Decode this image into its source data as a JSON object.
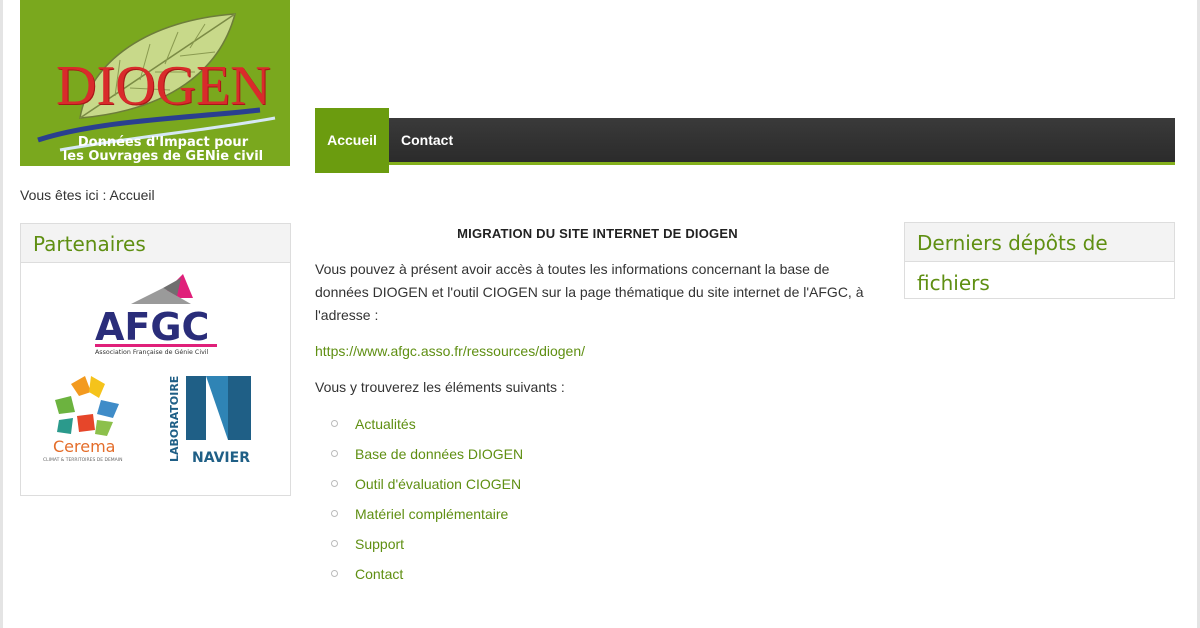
{
  "logo": {
    "title": "DIOGEN",
    "subtitle_line1": "Données d'Impact pour",
    "subtitle_line2": "les Ouvrages de GENie civil",
    "background": "#7aa81e",
    "title_color": "#d92b2b"
  },
  "nav": {
    "items": [
      {
        "label": "Accueil",
        "active": true
      },
      {
        "label": "Contact",
        "active": false
      }
    ],
    "active_color": "#6b9c0f",
    "bar_color": "#2e2e2e"
  },
  "breadcrumb": "Vous êtes ici : Accueil",
  "sidebar_left": {
    "title": "Partenaires",
    "logos": [
      {
        "name": "AFGC",
        "caption": "Association Française de Génie Civil"
      },
      {
        "name": "Cerema",
        "caption": "CLIMAT & TERRITOIRES DE DEMAIN"
      },
      {
        "name": "NAVIER",
        "caption": "LABORATOIRE"
      }
    ]
  },
  "sidebar_right": {
    "title": "Derniers dépôts de fichiers"
  },
  "main": {
    "title": "MIGRATION DU SITE INTERNET DE DIOGEN",
    "paragraph1_line1": "Vous pouvez à présent avoir accès à toutes les informations concernant la base de",
    "paragraph1_line2": "données DIOGEN et l'outil CIOGEN sur la page thématique du site internet de l'AFGC, à",
    "paragraph1_line3": "l'adresse :",
    "link": "https://www.afgc.asso.fr/ressources/diogen/",
    "paragraph2": "Vous y trouverez les éléments suivants :",
    "list": [
      "Actualités",
      "Base de données DIOGEN",
      "Outil d'évaluation CIOGEN",
      "Matériel complémentaire",
      "Support",
      "Contact"
    ]
  },
  "colors": {
    "accent_green": "#5f8f12",
    "header_bg": "#f3f3f3",
    "border": "#dddddd"
  }
}
